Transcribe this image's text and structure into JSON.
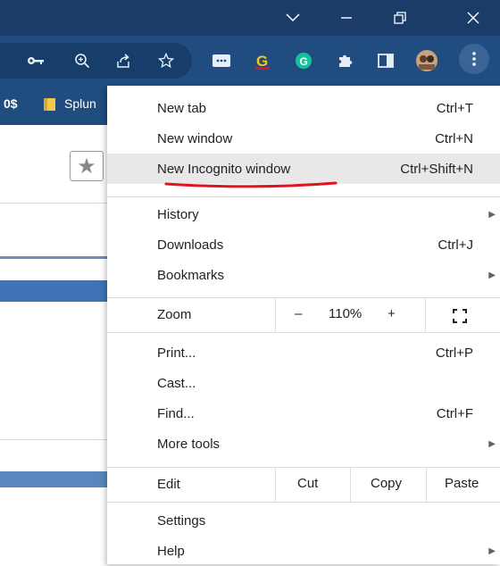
{
  "window": {
    "controls": [
      "minimize-icon",
      "restore-icon",
      "close-icon"
    ]
  },
  "toolbar": {
    "icons": [
      "key-icon",
      "zoom-icon",
      "share-icon",
      "bookmark-star-icon",
      "ext-dots-icon",
      "ext-g-icon",
      "grammarly-icon",
      "extensions-puzzle-icon",
      "sidebar-icon",
      "profile-avatar",
      "menu-kebab-icon"
    ]
  },
  "bookmarks": {
    "left_text": "0$",
    "folder_label": "Splun"
  },
  "menu": {
    "items": [
      {
        "label": "New tab",
        "shortcut": "Ctrl+T"
      },
      {
        "label": "New window",
        "shortcut": "Ctrl+N"
      },
      {
        "label": "New Incognito window",
        "shortcut": "Ctrl+Shift+N"
      },
      {
        "label": "History",
        "shortcut": ""
      },
      {
        "label": "Downloads",
        "shortcut": "Ctrl+J"
      },
      {
        "label": "Bookmarks",
        "shortcut": ""
      },
      {
        "label": "Print...",
        "shortcut": "Ctrl+P"
      },
      {
        "label": "Cast...",
        "shortcut": ""
      },
      {
        "label": "Find...",
        "shortcut": "Ctrl+F"
      },
      {
        "label": "More tools",
        "shortcut": ""
      },
      {
        "label": "Settings",
        "shortcut": ""
      },
      {
        "label": "Help",
        "shortcut": ""
      }
    ],
    "zoom": {
      "label": "Zoom",
      "minus": "–",
      "value": "110%",
      "plus": "+"
    },
    "edit": {
      "label": "Edit",
      "cut": "Cut",
      "copy": "Copy",
      "paste": "Paste"
    }
  },
  "colors": {
    "titlebar": "#1b3b69",
    "toolbar": "#204c80",
    "highlight": "#e8e8e8",
    "annotation": "#e0141e"
  }
}
